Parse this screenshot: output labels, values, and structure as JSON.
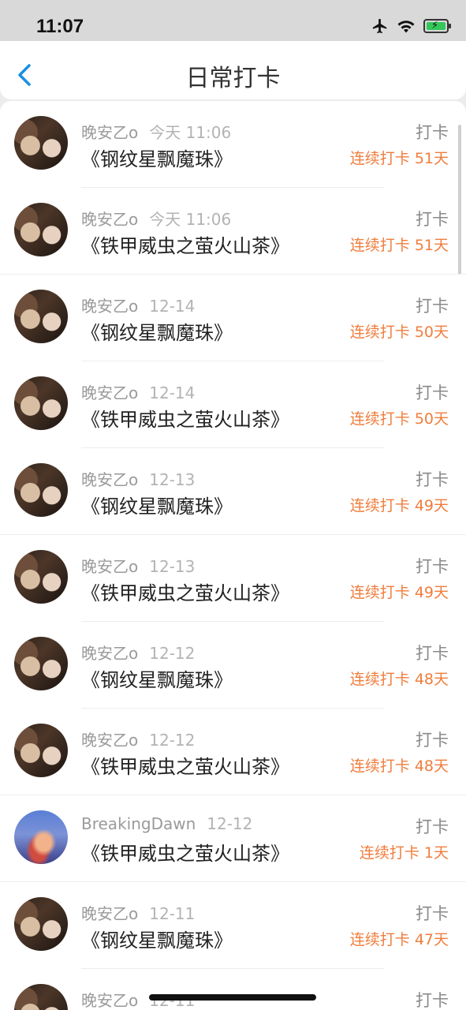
{
  "status_bar": {
    "time": "11:07"
  },
  "nav": {
    "title": "日常打卡"
  },
  "items": [
    {
      "user": "晚安乙o",
      "time": "今天 11:06",
      "title": "《钢纹星飘魔珠》",
      "action": "打卡",
      "streak": "连续打卡 51天",
      "avatar": "photo"
    },
    {
      "user": "晚安乙o",
      "time": "今天 11:06",
      "title": "《铁甲威虫之萤火山茶》",
      "action": "打卡",
      "streak": "连续打卡 51天",
      "avatar": "photo"
    },
    {
      "user": "晚安乙o",
      "time": "12-14",
      "title": "《钢纹星飘魔珠》",
      "action": "打卡",
      "streak": "连续打卡 50天",
      "avatar": "photo"
    },
    {
      "user": "晚安乙o",
      "time": "12-14",
      "title": "《铁甲威虫之萤火山茶》",
      "action": "打卡",
      "streak": "连续打卡 50天",
      "avatar": "photo"
    },
    {
      "user": "晚安乙o",
      "time": "12-13",
      "title": "《钢纹星飘魔珠》",
      "action": "打卡",
      "streak": "连续打卡 49天",
      "avatar": "photo"
    },
    {
      "user": "晚安乙o",
      "time": "12-13",
      "title": "《铁甲威虫之萤火山茶》",
      "action": "打卡",
      "streak": "连续打卡 49天",
      "avatar": "photo"
    },
    {
      "user": "晚安乙o",
      "time": "12-12",
      "title": "《钢纹星飘魔珠》",
      "action": "打卡",
      "streak": "连续打卡 48天",
      "avatar": "photo"
    },
    {
      "user": "晚安乙o",
      "time": "12-12",
      "title": "《铁甲威虫之萤火山茶》",
      "action": "打卡",
      "streak": "连续打卡 48天",
      "avatar": "photo"
    },
    {
      "user": "BreakingDawn",
      "time": "12-12",
      "title": "《铁甲威虫之萤火山茶》",
      "action": "打卡",
      "streak": "连续打卡 1天",
      "avatar": "sky"
    },
    {
      "user": "晚安乙o",
      "time": "12-11",
      "title": "《钢纹星飘魔珠》",
      "action": "打卡",
      "streak": "连续打卡 47天",
      "avatar": "photo"
    },
    {
      "user": "晚安乙o",
      "time": "12-11",
      "title": "",
      "action": "打卡",
      "streak": "",
      "avatar": "photo"
    }
  ],
  "colors": {
    "accent": "#1a8fe3",
    "streak": "#f07d3c"
  }
}
